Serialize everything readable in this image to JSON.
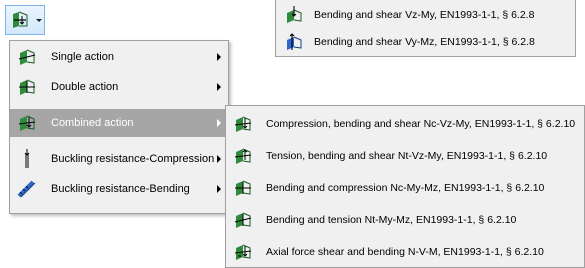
{
  "toolbar": {
    "button_icon": "beam-icon"
  },
  "top_menu": {
    "items": [
      {
        "label": "Bending and shear Vz-My,  EN1993-1-1, § 6.2.8",
        "icon": "beam-vertical-arrow-icon"
      },
      {
        "label": "Bending and shear Vy-Mz,  EN1993-1-1, § 6.2.8",
        "icon": "beam-horizontal-arrow-icon"
      }
    ]
  },
  "main_menu": {
    "items": [
      {
        "label": "Single action",
        "icon": "beam-single-icon",
        "has_submenu": true
      },
      {
        "label": "Double action",
        "icon": "beam-double-icon",
        "has_submenu": true
      },
      {
        "label": "Combined action",
        "icon": "beam-combined-icon",
        "has_submenu": true,
        "highlighted": true
      },
      {
        "label": "Buckling resistance-Compression",
        "icon": "column-buckling-icon",
        "has_submenu": true
      },
      {
        "label": "Buckling resistance-Bending",
        "icon": "beam-buckling-icon",
        "has_submenu": true
      }
    ]
  },
  "sub_menu": {
    "items": [
      {
        "label": "Compression, bending and shear Nc-Vz-My,  EN1993-1-1, § 6.2.10",
        "icon": "beam-combined-icon"
      },
      {
        "label": "Tension, bending and shear Nt-Vz-My,  EN1993-1-1, § 6.2.10",
        "icon": "beam-combined-icon"
      },
      {
        "label": "Bending and compression Nc-My-Mz,  EN1993-1-1, § 6.2.10",
        "icon": "beam-combined-icon"
      },
      {
        "label": "Bending and tension Nt-My-Mz,  EN1993-1-1, § 6.2.10",
        "icon": "beam-combined-icon"
      },
      {
        "label": "Axial force shear and bending N-V-M,  EN1993-1-1, § 6.2.10",
        "icon": "beam-combined-icon"
      }
    ]
  },
  "colors": {
    "menu_bg": "#f0f0f0",
    "highlight_bg": "#a6a6a6",
    "icon_green": "#2e8b3a",
    "icon_blue": "#2f66c7"
  }
}
